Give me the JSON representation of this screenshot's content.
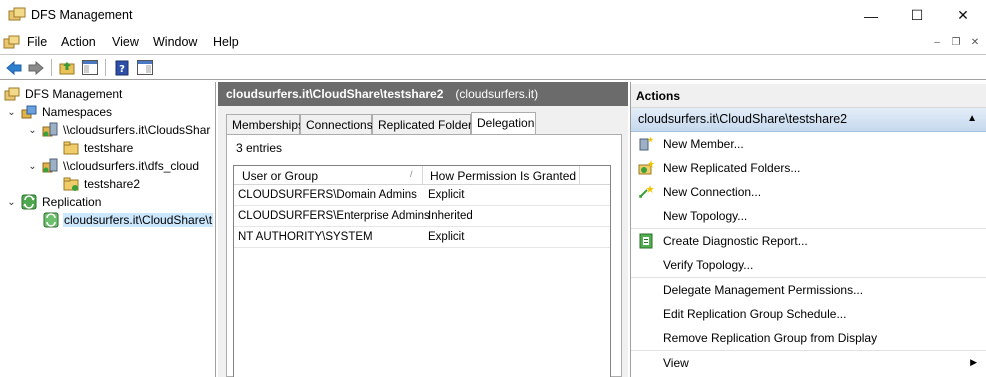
{
  "window": {
    "title": "DFS Management",
    "minimize": "—",
    "maximize": "☐",
    "close": "✕"
  },
  "menu": {
    "items": [
      "File",
      "Action",
      "View",
      "Window",
      "Help"
    ],
    "mdi_min": "‒",
    "mdi_restore": "❐",
    "mdi_close": "✕"
  },
  "tree": {
    "root": "DFS Management",
    "namespaces": "Namespaces",
    "ns1": "\\\\cloudsurfers.it\\CloudsShar",
    "ns1_child": "testshare",
    "ns2": "\\\\cloudsurfers.it\\dfs_cloud",
    "ns2_child": "testshare2",
    "replication": "Replication",
    "rep_child": "cloudsurfers.it\\CloudShare\\t"
  },
  "middle": {
    "header_bold": "cloudsurfers.it\\CloudShare\\testshare2",
    "header_domain": "(cloudsurfers.it)",
    "tabs": [
      "Memberships",
      "Connections",
      "Replicated Folders",
      "Delegation"
    ],
    "active_tab": "Delegation",
    "entries": "3 entries",
    "columns": [
      "User or Group",
      "How Permission Is Granted"
    ],
    "rows": [
      {
        "user": "CLOUDSURFERS\\Domain Admins",
        "how": "Explicit"
      },
      {
        "user": "CLOUDSURFERS\\Enterprise Admins",
        "how": "Inherited"
      },
      {
        "user": "NT AUTHORITY\\SYSTEM",
        "how": "Explicit"
      }
    ]
  },
  "actions": {
    "title": "Actions",
    "section": "cloudsurfers.it\\CloudShare\\testshare2",
    "items": [
      "New Member...",
      "New Replicated Folders...",
      "New Connection...",
      "New Topology...",
      "Create Diagnostic Report...",
      "Verify Topology...",
      "Delegate Management Permissions...",
      "Edit Replication Group Schedule...",
      "Remove Replication Group from Display",
      "View"
    ]
  },
  "colors": {
    "header_bg": "#6b6b6b",
    "selection": "#cce8ff",
    "section_bg": "#c6d9ee"
  }
}
